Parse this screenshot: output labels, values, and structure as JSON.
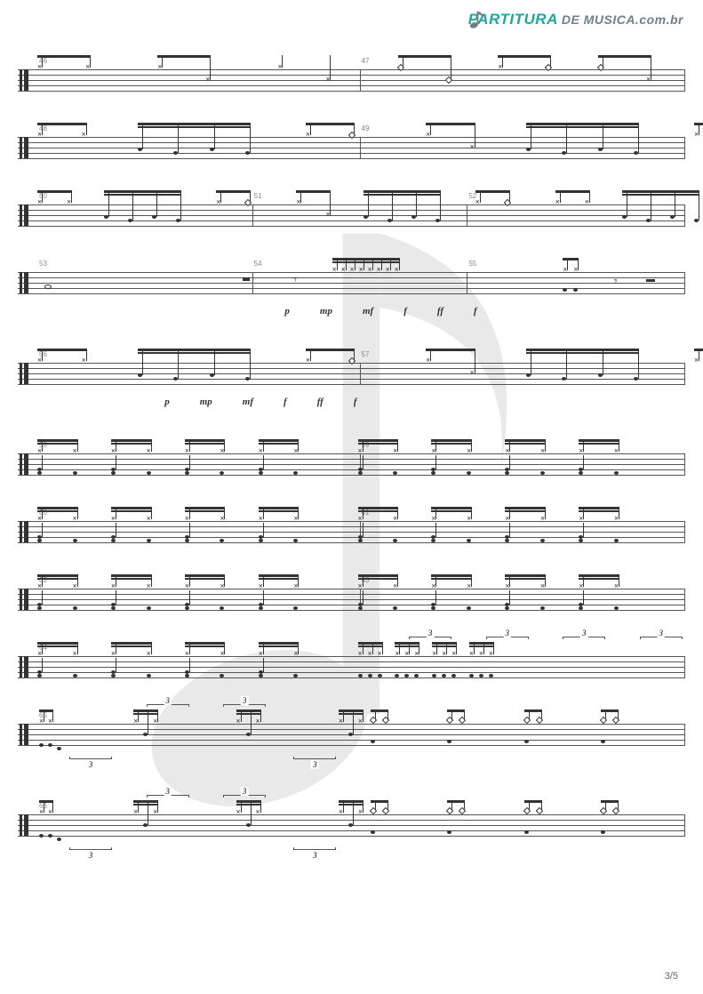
{
  "brand": {
    "part1": "PARTITURA",
    "part2": "DE MUSICA.com.br"
  },
  "page_number": "3/5",
  "tuplet_label": "3",
  "dynamics_row_1": [
    "p",
    "mp",
    "mf",
    "f",
    "ff",
    "f"
  ],
  "dynamics_row_2": [
    "p",
    "mp",
    "mf",
    "f",
    "ff",
    "f"
  ],
  "systems": [
    {
      "measures": [
        46,
        47
      ],
      "style": "sparse",
      "has_dynamics": false,
      "tuplets": []
    },
    {
      "measures": [
        48,
        49
      ],
      "style": "mixed",
      "has_dynamics": false,
      "tuplets": []
    },
    {
      "measures": [
        50,
        51,
        52
      ],
      "style": "mixed",
      "has_dynamics": false,
      "tuplets": []
    },
    {
      "measures": [
        53,
        54,
        55
      ],
      "style": "whole-rest",
      "has_dynamics": "row1",
      "tuplets": []
    },
    {
      "measures": [
        56,
        57
      ],
      "style": "mixed",
      "has_dynamics": "row2",
      "tuplets": []
    },
    {
      "measures": [
        58,
        59
      ],
      "style": "dense",
      "has_dynamics": false,
      "tuplets": []
    },
    {
      "measures": [
        60,
        61
      ],
      "style": "dense",
      "has_dynamics": false,
      "tuplets": []
    },
    {
      "measures": [
        62,
        63
      ],
      "style": "dense",
      "has_dynamics": false,
      "tuplets": []
    },
    {
      "measures": [
        64
      ],
      "style": "dense-triplet-end",
      "has_dynamics": false,
      "tuplets": [
        {
          "pos": 58
        },
        {
          "pos": 70
        },
        {
          "pos": 82
        },
        {
          "pos": 94
        }
      ]
    },
    {
      "measures": [
        65
      ],
      "style": "triplet-wide",
      "has_dynamics": false,
      "tuplets": [
        {
          "pos": 5,
          "below": true
        },
        {
          "pos": 17,
          "above": true
        },
        {
          "pos": 29,
          "above": true
        },
        {
          "pos": 40,
          "below": true
        }
      ]
    },
    {
      "measures": [
        66
      ],
      "style": "triplet-wide",
      "has_dynamics": false,
      "tuplets": [
        {
          "pos": 5,
          "below": true
        },
        {
          "pos": 17,
          "above": true
        },
        {
          "pos": 29,
          "above": true
        },
        {
          "pos": 40,
          "below": true
        }
      ]
    }
  ]
}
